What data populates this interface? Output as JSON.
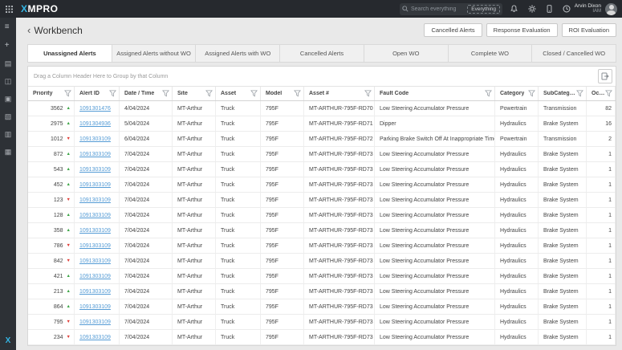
{
  "topbar": {
    "logo": "XMPRO",
    "search": {
      "placeholder": "Search everything",
      "scope": "Everything"
    },
    "user": {
      "name": "Arvin Dixon",
      "role": "IAM"
    }
  },
  "sidebar": {
    "items": [
      {
        "name": "menu-icon",
        "glyph": "≡"
      },
      {
        "name": "add-icon",
        "glyph": "+"
      },
      {
        "name": "dashboard-icon",
        "glyph": "▤"
      },
      {
        "name": "datastream-icon",
        "glyph": "◫"
      },
      {
        "name": "media-icon",
        "glyph": "▣"
      },
      {
        "name": "link-icon",
        "glyph": "▧"
      },
      {
        "name": "reports-icon",
        "glyph": "▥"
      },
      {
        "name": "calendar-icon",
        "glyph": "▦"
      }
    ],
    "logo_glyph": "X"
  },
  "header": {
    "back": "‹",
    "title": "Workbench",
    "buttons": [
      "Cancelled Alerts",
      "Response Evaluation",
      "ROI Evaluation"
    ]
  },
  "tabs": {
    "active": 0,
    "items": [
      "Unassigned Alerts",
      "Assigned Alerts without WO",
      "Assigned Alerts with WO",
      "Cancelled Alerts",
      "Open WO",
      "Complete WO",
      "Closed / Cancelled WO"
    ]
  },
  "grid": {
    "group_hint": "Drag a Column Header Here to Group by that Column",
    "columns": [
      "Priority",
      "Alert ID",
      "Date / Time",
      "Site",
      "Asset",
      "Model",
      "Asset #",
      "Fault Code",
      "Category",
      "SubCategory",
      "Occurren..."
    ],
    "rows": [
      {
        "priority": "3562",
        "trend": "up",
        "alert_id": "1091301476",
        "date": "4/04/2024",
        "site": "MT-Arthur",
        "asset": "Truck",
        "model": "795F",
        "asset_no": "MT-ARTHUR-795F-RD70",
        "fault_code": "Low Steering Accumulator Pressure",
        "category": "Powertrain",
        "subcategory": "Transmission",
        "occurrences": "82"
      },
      {
        "priority": "2975",
        "trend": "up",
        "alert_id": "1091304936",
        "date": "5/04/2024",
        "site": "MT-Arthur",
        "asset": "Truck",
        "model": "795F",
        "asset_no": "MT-ARTHUR-795F-RD71",
        "fault_code": "Dipper",
        "category": "Hydraulics",
        "subcategory": "Brake System",
        "occurrences": "16"
      },
      {
        "priority": "1012",
        "trend": "down",
        "alert_id": "1091303109",
        "date": "6/04/2024",
        "site": "MT-Arthur",
        "asset": "Truck",
        "model": "795F",
        "asset_no": "MT-ARTHUR-795F-RD72",
        "fault_code": "Parking Brake Switch Off At Inappropriate Time",
        "category": "Powertrain",
        "subcategory": "Transmission",
        "occurrences": "2"
      },
      {
        "priority": "872",
        "trend": "up",
        "alert_id": "1091303109",
        "date": "7/04/2024",
        "site": "MT-Arthur",
        "asset": "Truck",
        "model": "795F",
        "asset_no": "MT-ARTHUR-795F-RD73",
        "fault_code": "Low Steering Accumulator Pressure",
        "category": "Hydraulics",
        "subcategory": "Brake System",
        "occurrences": "1"
      },
      {
        "priority": "543",
        "trend": "up",
        "alert_id": "1091303109",
        "date": "7/04/2024",
        "site": "MT-Arthur",
        "asset": "Truck",
        "model": "795F",
        "asset_no": "MT-ARTHUR-795F-RD73",
        "fault_code": "Low Steering Accumulator Pressure",
        "category": "Hydraulics",
        "subcategory": "Brake System",
        "occurrences": "1"
      },
      {
        "priority": "452",
        "trend": "up",
        "alert_id": "1091303109",
        "date": "7/04/2024",
        "site": "MT-Arthur",
        "asset": "Truck",
        "model": "795F",
        "asset_no": "MT-ARTHUR-795F-RD73",
        "fault_code": "Low Steering Accumulator Pressure",
        "category": "Hydraulics",
        "subcategory": "Brake System",
        "occurrences": "1"
      },
      {
        "priority": "123",
        "trend": "down",
        "alert_id": "1091303109",
        "date": "7/04/2024",
        "site": "MT-Arthur",
        "asset": "Truck",
        "model": "795F",
        "asset_no": "MT-ARTHUR-795F-RD73",
        "fault_code": "Low Steering Accumulator Pressure",
        "category": "Hydraulics",
        "subcategory": "Brake System",
        "occurrences": "1"
      },
      {
        "priority": "128",
        "trend": "up",
        "alert_id": "1091303109",
        "date": "7/04/2024",
        "site": "MT-Arthur",
        "asset": "Truck",
        "model": "795F",
        "asset_no": "MT-ARTHUR-795F-RD73",
        "fault_code": "Low Steering Accumulator Pressure",
        "category": "Hydraulics",
        "subcategory": "Brake System",
        "occurrences": "1"
      },
      {
        "priority": "358",
        "trend": "up",
        "alert_id": "1091303109",
        "date": "7/04/2024",
        "site": "MT-Arthur",
        "asset": "Truck",
        "model": "795F",
        "asset_no": "MT-ARTHUR-795F-RD73",
        "fault_code": "Low Steering Accumulator Pressure",
        "category": "Hydraulics",
        "subcategory": "Brake System",
        "occurrences": "1"
      },
      {
        "priority": "786",
        "trend": "down",
        "alert_id": "1091303109",
        "date": "7/04/2024",
        "site": "MT-Arthur",
        "asset": "Truck",
        "model": "795F",
        "asset_no": "MT-ARTHUR-795F-RD73",
        "fault_code": "Low Steering Accumulator Pressure",
        "category": "Hydraulics",
        "subcategory": "Brake System",
        "occurrences": "1"
      },
      {
        "priority": "842",
        "trend": "down",
        "alert_id": "1091303109",
        "date": "7/04/2024",
        "site": "MT-Arthur",
        "asset": "Truck",
        "model": "795F",
        "asset_no": "MT-ARTHUR-795F-RD73",
        "fault_code": "Low Steering Accumulator Pressure",
        "category": "Hydraulics",
        "subcategory": "Brake System",
        "occurrences": "1"
      },
      {
        "priority": "421",
        "trend": "up",
        "alert_id": "1091303109",
        "date": "7/04/2024",
        "site": "MT-Arthur",
        "asset": "Truck",
        "model": "795F",
        "asset_no": "MT-ARTHUR-795F-RD73",
        "fault_code": "Low Steering Accumulator Pressure",
        "category": "Hydraulics",
        "subcategory": "Brake System",
        "occurrences": "1"
      },
      {
        "priority": "213",
        "trend": "up",
        "alert_id": "1091303109",
        "date": "7/04/2024",
        "site": "MT-Arthur",
        "asset": "Truck",
        "model": "795F",
        "asset_no": "MT-ARTHUR-795F-RD73",
        "fault_code": "Low Steering Accumulator Pressure",
        "category": "Hydraulics",
        "subcategory": "Brake System",
        "occurrences": "1"
      },
      {
        "priority": "864",
        "trend": "up",
        "alert_id": "1091303109",
        "date": "7/04/2024",
        "site": "MT-Arthur",
        "asset": "Truck",
        "model": "795F",
        "asset_no": "MT-ARTHUR-795F-RD73",
        "fault_code": "Low Steering Accumulator Pressure",
        "category": "Hydraulics",
        "subcategory": "Brake System",
        "occurrences": "1"
      },
      {
        "priority": "795",
        "trend": "down",
        "alert_id": "1091303109",
        "date": "7/04/2024",
        "site": "MT-Arthur",
        "asset": "Truck",
        "model": "795F",
        "asset_no": "MT-ARTHUR-795F-RD73",
        "fault_code": "Low Steering Accumulator Pressure",
        "category": "Hydraulics",
        "subcategory": "Brake System",
        "occurrences": "1"
      },
      {
        "priority": "234",
        "trend": "down",
        "alert_id": "1091303109",
        "date": "7/04/2024",
        "site": "MT-Arthur",
        "asset": "Truck",
        "model": "795F",
        "asset_no": "MT-ARTHUR-795F-RD73",
        "fault_code": "Low Steering Accumulator Pressure",
        "category": "Hydraulics",
        "subcategory": "Brake System",
        "occurrences": "1"
      }
    ]
  },
  "colors": {
    "topbar_bg": "#26292e",
    "sidebar_bg": "#2d3136",
    "accent_blue": "#35b6e5",
    "link_blue": "#549bd5",
    "trend_up": "#3fa648",
    "trend_down": "#e0403a"
  }
}
